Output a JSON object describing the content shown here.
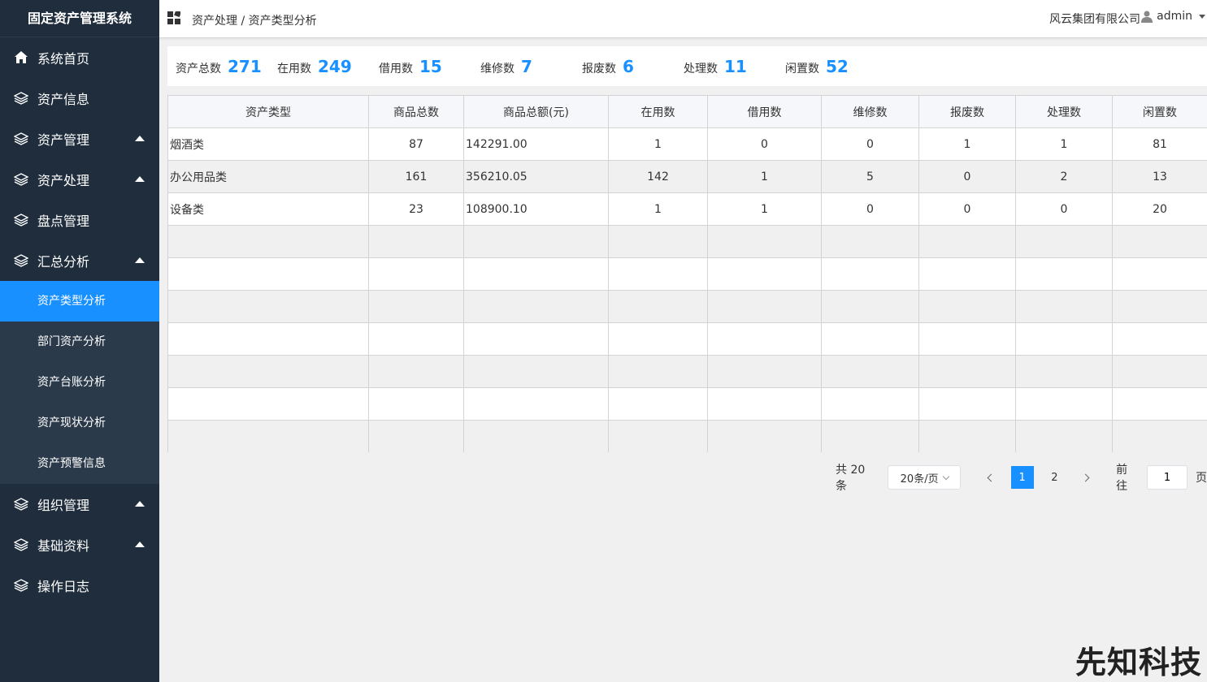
{
  "app": {
    "title": "固定资产管理系统"
  },
  "sidebar": {
    "items": [
      {
        "label": "系统首页",
        "icon": "home-icon"
      },
      {
        "label": "资产信息",
        "icon": "layers-icon"
      },
      {
        "label": "资产管理",
        "icon": "layers-icon"
      },
      {
        "label": "资产处理",
        "icon": "layers-icon"
      },
      {
        "label": "盘点管理",
        "icon": "layers-icon"
      },
      {
        "label": "汇总分析",
        "icon": "layers-icon"
      },
      {
        "label": "组织管理",
        "icon": "layers-icon"
      },
      {
        "label": "基础资料",
        "icon": "layers-icon"
      },
      {
        "label": "操作日志",
        "icon": "layers-icon"
      }
    ],
    "sub_items": [
      {
        "label": "资产类型分析",
        "active": true
      },
      {
        "label": "部门资产分析"
      },
      {
        "label": "资产台账分析"
      },
      {
        "label": "资产现状分析"
      },
      {
        "label": "资产预警信息"
      }
    ]
  },
  "header": {
    "breadcrumb": "资产处理 / 资产类型分析",
    "company": "风云集团有限公司",
    "user": "admin"
  },
  "stats": [
    {
      "label": "资产总数",
      "value": "271"
    },
    {
      "label": "在用数",
      "value": "249"
    },
    {
      "label": "借用数",
      "value": "15"
    },
    {
      "label": "维修数",
      "value": "7"
    },
    {
      "label": "报废数",
      "value": "6"
    },
    {
      "label": "处理数",
      "value": "11"
    },
    {
      "label": "闲置数",
      "value": "52"
    }
  ],
  "table": {
    "columns": [
      "资产类型",
      "商品总数",
      "商品总额(元)",
      "在用数",
      "借用数",
      "维修数",
      "报废数",
      "处理数",
      "闲置数"
    ],
    "rows": [
      [
        "烟酒类",
        "87",
        "142291.00",
        "1",
        "0",
        "0",
        "1",
        "1",
        "81"
      ],
      [
        "办公用品类",
        "161",
        "356210.05",
        "142",
        "1",
        "5",
        "0",
        "2",
        "13"
      ],
      [
        "设备类",
        "23",
        "108900.10",
        "1",
        "1",
        "0",
        "0",
        "0",
        "20"
      ]
    ]
  },
  "pagination": {
    "total": "共 20 条",
    "page_size": "20条/页",
    "pages": [
      "1",
      "2"
    ],
    "current": "1",
    "goto_label": "前往",
    "goto_value": "1",
    "page_suffix": "页"
  },
  "watermark": "先知科技",
  "colors": {
    "sidebar_bg": "#1f2d3d",
    "accent": "#1890ff"
  }
}
